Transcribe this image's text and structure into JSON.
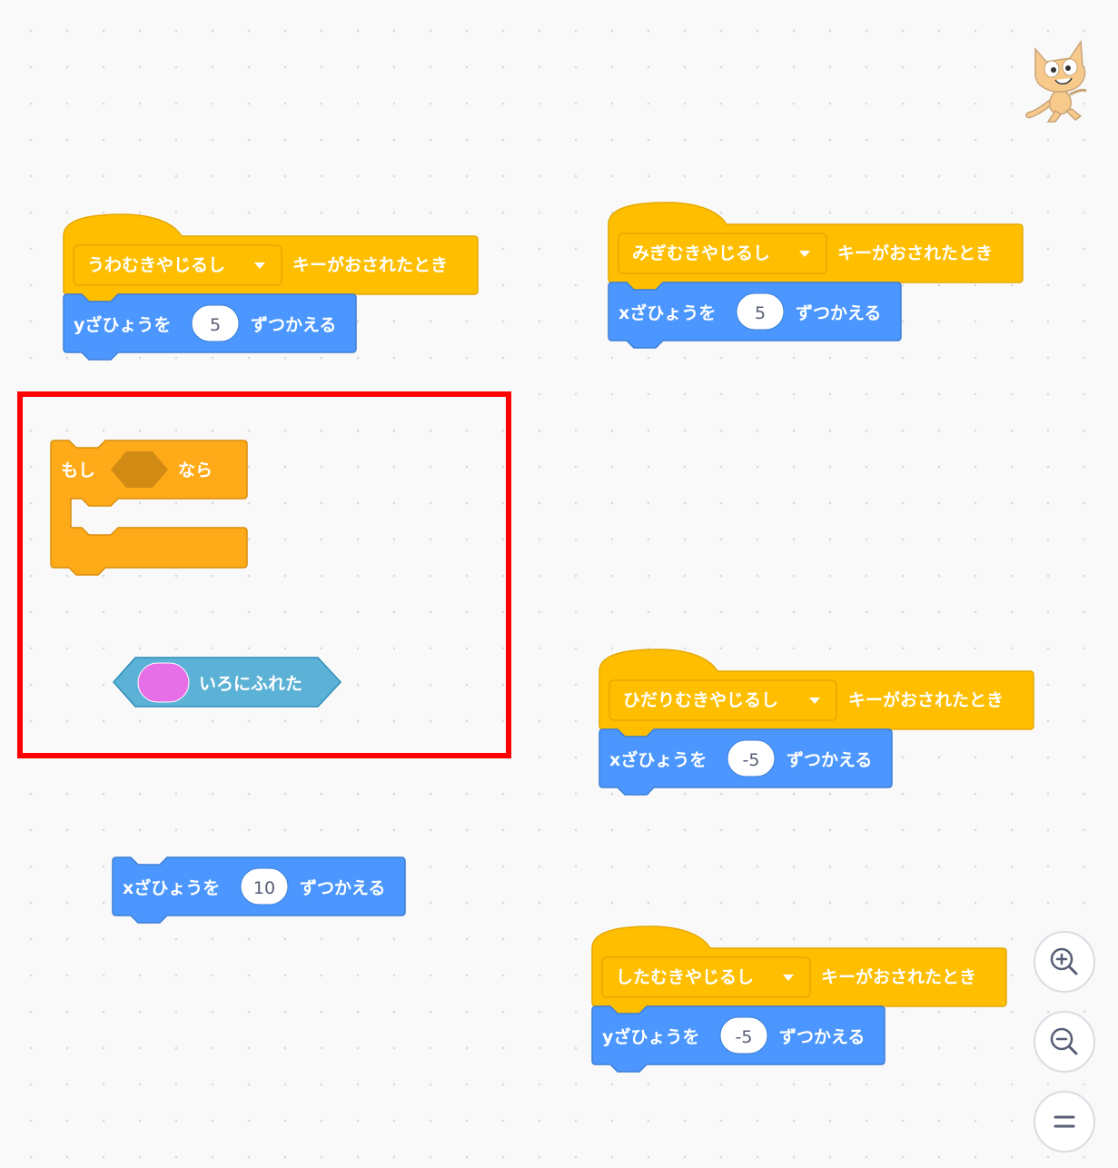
{
  "events": [
    {
      "key": "うわむきやじるし",
      "suffix": "キーがおされたとき",
      "motion_label": "yざひょうを",
      "value": "5",
      "motion_suffix": "ずつかえる"
    },
    {
      "key": "みぎむきやじるし",
      "suffix": "キーがおされたとき",
      "motion_label": "xざひょうを",
      "value": "5",
      "motion_suffix": "ずつかえる"
    },
    {
      "key": "ひだりむきやじるし",
      "suffix": "キーがおされたとき",
      "motion_label": "xざひょうを",
      "value": "-5",
      "motion_suffix": "ずつかえる"
    },
    {
      "key": "したむきやじるし",
      "suffix": "キーがおされたとき",
      "motion_label": "yざひょうを",
      "value": "-5",
      "motion_suffix": "ずつかえる"
    }
  ],
  "if_block": {
    "prefix": "もし",
    "suffix": "なら"
  },
  "touching_color": {
    "label": "いろにふれた",
    "color": "#e66ee6"
  },
  "loose_motion": {
    "label": "xざひょうを",
    "value": "10",
    "suffix": "ずつかえる"
  },
  "colors": {
    "events": "#ffbf00",
    "events_border": "#e6a800",
    "motion": "#4c97ff",
    "motion_border": "#3d7fd6",
    "control": "#ffab19",
    "control_border": "#d98e0b",
    "sensing": "#5cb1d6",
    "selection": "#ff0000"
  },
  "zoom": {
    "in_icon": "zoom-in-icon",
    "out_icon": "zoom-out-icon",
    "reset_icon": "zoom-reset-icon"
  },
  "mascot_icon": "scratch-cat-icon"
}
